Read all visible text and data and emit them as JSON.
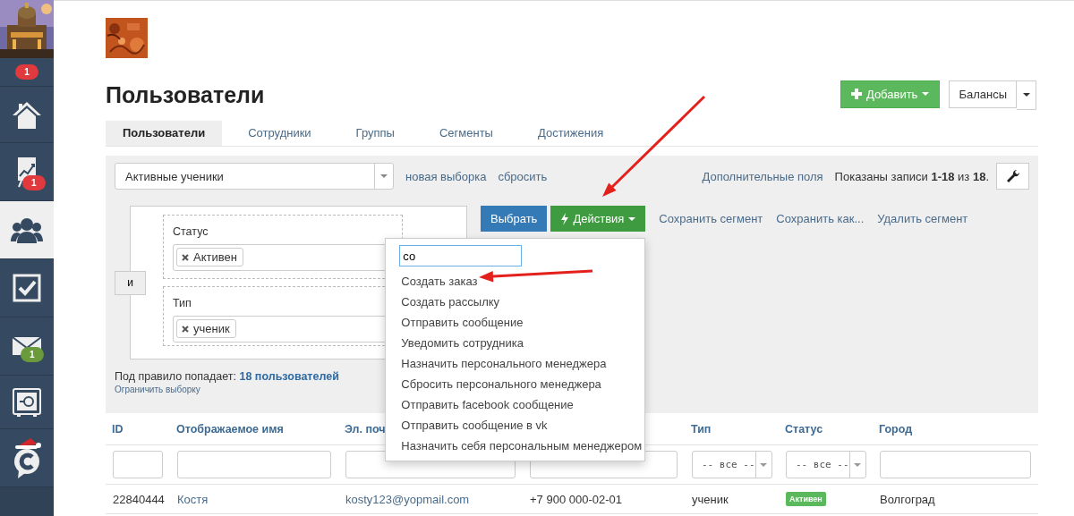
{
  "sidebar": {
    "items": [
      {
        "kind": "notifications",
        "badge": "1",
        "color": "#e0393e",
        "selected": false
      },
      {
        "kind": "home",
        "selected": false
      },
      {
        "kind": "chart",
        "badge": "1",
        "color": "#e0393e",
        "selected": false
      },
      {
        "kind": "users",
        "selected": true
      },
      {
        "kind": "tasks",
        "selected": false
      },
      {
        "kind": "mail",
        "badge": "1",
        "color": "#6a9a3b",
        "selected": false
      },
      {
        "kind": "safe",
        "selected": false
      },
      {
        "kind": "logo",
        "selected": false
      }
    ]
  },
  "header": {
    "title": "Пользователи",
    "add_button": "Добавить",
    "balances_button": "Балансы"
  },
  "tabs": [
    {
      "label": "Пользователи",
      "selected": true
    },
    {
      "label": "Сотрудники",
      "selected": false
    },
    {
      "label": "Группы",
      "selected": false
    },
    {
      "label": "Сегменты",
      "selected": false
    },
    {
      "label": "Достижения",
      "selected": false
    }
  ],
  "filters": {
    "segment": "Активные ученики",
    "links": [
      "новая выборка",
      "сбросить"
    ],
    "extra_fields_link": "Дополнительные поля",
    "records": "Показаны записи **1-18** из **18**.",
    "join": "и",
    "conditions": [
      {
        "label": "Статус",
        "tag": "Активен"
      },
      {
        "label": "Тип",
        "tag": "ученик"
      }
    ],
    "select_button": "Выбрать",
    "actions_button": "Действия",
    "segment_links": [
      "Сохранить сегмент",
      "Сохранить как...",
      "Удалить сегмент"
    ],
    "match_text": "Под правило попадает:",
    "match_link": "18 пользователей",
    "limit_link": "Ограничить выборку"
  },
  "actions_menu": {
    "search": "со",
    "items": [
      "Создать заказ",
      "Создать рассылку",
      "Отправить сообщение",
      "Уведомить сотрудника",
      "Назначить персонального менеджера",
      "Сбросить персонального менеджера",
      "Отправить facebook сообщение",
      "Отправить сообщение в vk",
      "Назначить себя персональным менеджером"
    ]
  },
  "table": {
    "columns": [
      {
        "label": "ID",
        "kind": "text"
      },
      {
        "label": "Отображаемое имя",
        "kind": "text"
      },
      {
        "label": "Эл. поч",
        "kind": "text"
      },
      {
        "kind": "text"
      },
      {
        "label": "Тип",
        "kind": "select",
        "value": "-- все --"
      },
      {
        "label": "Статус",
        "kind": "select",
        "value": "-- все --"
      },
      {
        "label": "Город",
        "kind": "text"
      }
    ],
    "rows": [
      {
        "cells": [
          {
            "text": "22840444",
            "kind": "plain"
          },
          {
            "text": "Костя",
            "kind": "link"
          },
          {
            "text": "kosty123@yopmail.com",
            "kind": "link"
          },
          {
            "text": "+7 900 000-02-01",
            "kind": "plain"
          },
          {
            "text": "ученик",
            "kind": "plain"
          },
          {
            "text": "Активен",
            "kind": "badge"
          },
          {
            "text": "Волгоград",
            "kind": "plain"
          }
        ]
      }
    ]
  }
}
